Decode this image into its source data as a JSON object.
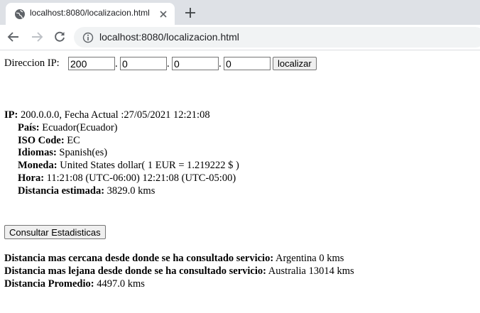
{
  "browser": {
    "tab_title": "localhost:8080/localizacion.html",
    "url": "localhost:8080/localizacion.html"
  },
  "form": {
    "label": "Direccion IP:",
    "octets": [
      "200",
      "0",
      "0",
      "0"
    ],
    "button": "localizar"
  },
  "result": {
    "ip_label": "IP:",
    "ip_value": "200.0.0.0, Fecha Actual :27/05/2021 12:21:08",
    "rows": [
      {
        "label": "País:",
        "value": "Ecuador(Ecuador)"
      },
      {
        "label": "ISO Code:",
        "value": "EC"
      },
      {
        "label": "Idiomas:",
        "value": "Spanish(es)"
      },
      {
        "label": "Moneda:",
        "value": "United States dollar( 1 EUR = 1.219222 $ )"
      },
      {
        "label": "Hora:",
        "value": "11:21:08 (UTC-06:00) 12:21:08 (UTC-05:00)"
      },
      {
        "label": "Distancia estimada:",
        "value": "3829.0 kms"
      }
    ]
  },
  "stats": {
    "button": "Consultar Estadisticas",
    "closest_label": "Distancia mas cercana desde donde se ha consultado servicio:",
    "closest_value": "Argentina 0 kms",
    "farthest_label": "Distancia mas lejana desde donde se ha consultado servicio:",
    "farthest_value": "Australia 13014 kms",
    "average_label": "Distancia Promedio:",
    "average_value": "4497.0 kms"
  }
}
